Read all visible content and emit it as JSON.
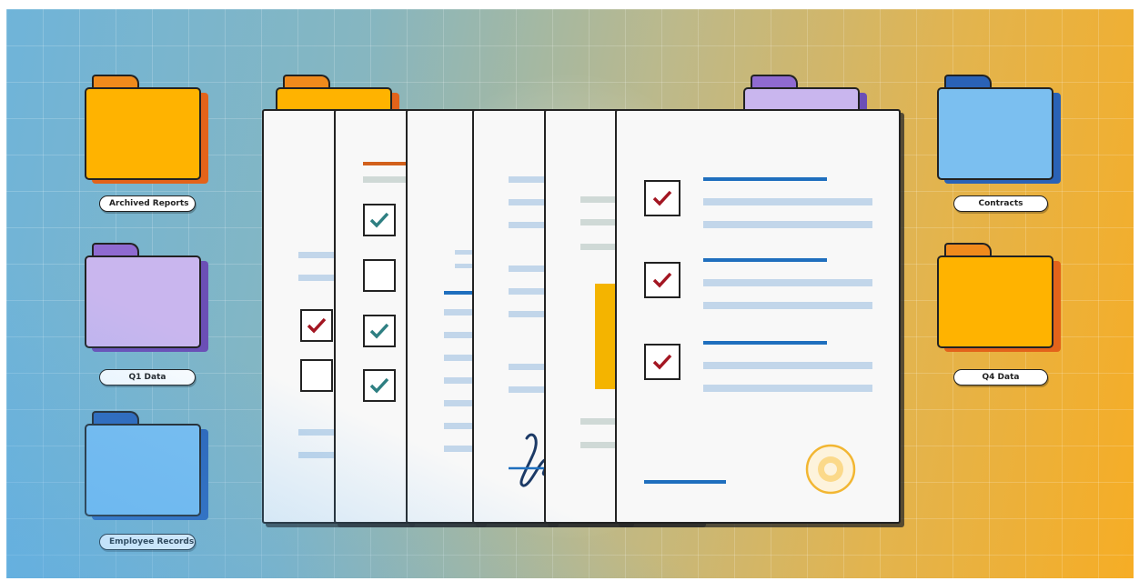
{
  "folders": [
    {
      "label": "Archived Reports",
      "color": "#ffb300",
      "shade": "#e3631a",
      "side": "left",
      "row": 0
    },
    {
      "label": "Q1 Data",
      "color": "#c9b6ee",
      "shade": "#6b4fb6",
      "side": "left",
      "row": 1
    },
    {
      "label": "Employee Records",
      "color": "#7bbff0",
      "shade": "#2a62b6",
      "side": "left",
      "row": 2
    },
    {
      "label": "Contracts",
      "color": "#7bbff0",
      "shade": "#2a62b6",
      "side": "right",
      "row": 0
    },
    {
      "label": "Q4 Data",
      "color": "#ffb300",
      "shade": "#e3631a",
      "side": "right",
      "row": 1
    }
  ],
  "colors": {
    "check_red": "#a31622",
    "check_teal": "#2e7f82",
    "accent_blue": "#1f6fbe",
    "accent_orange": "#d2601c",
    "highlight_yellow": "#f4b400",
    "seal_gold": "#f2b632"
  },
  "documents": [
    {
      "name": "document-1",
      "checkboxes": [
        "checked-red",
        "empty"
      ]
    },
    {
      "name": "document-2",
      "checkboxes": [
        "checked-teal",
        "empty",
        "checked-teal",
        "checked-teal"
      ]
    },
    {
      "name": "document-3",
      "checkboxes": []
    },
    {
      "name": "document-4",
      "has_signature": true
    },
    {
      "name": "document-5",
      "has_highlight": true
    },
    {
      "name": "document-6",
      "checkboxes": [
        "checked-red",
        "checked-red",
        "checked-red"
      ],
      "has_seal": true
    }
  ],
  "icons": [
    "folder-icon",
    "checkbox-icon",
    "signature-icon",
    "seal-icon"
  ]
}
